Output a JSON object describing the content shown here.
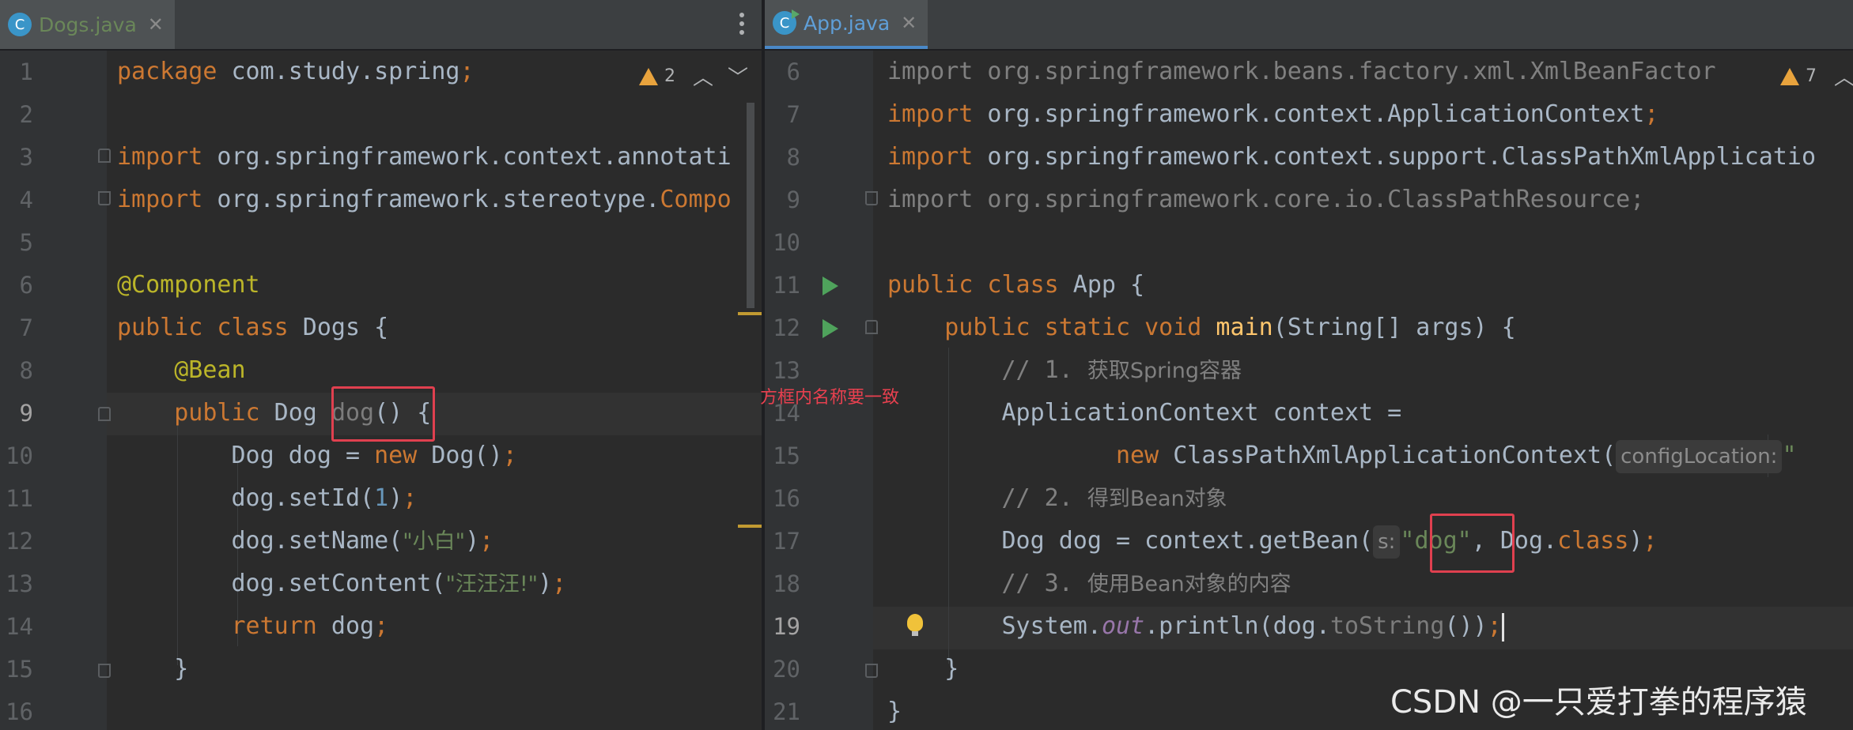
{
  "left_editor": {
    "tab": {
      "icon_letter": "C",
      "title": "Dogs.java",
      "close": "✕"
    },
    "inspection": {
      "warnings": "2"
    },
    "line_numbers": [
      "1",
      "2",
      "3",
      "4",
      "5",
      "6",
      "7",
      "8",
      "9",
      "10",
      "11",
      "12",
      "13",
      "14",
      "15",
      "16"
    ],
    "current_line": "9",
    "lines": {
      "l1": {
        "kw": "package",
        "rest": " com.study.spring",
        "semi": ";"
      },
      "l3": {
        "kw": "import",
        "rest": " org.springframework.context.annotati"
      },
      "l4": {
        "kw": "import",
        "rest": " org.springframework.stereotype.",
        "cls": "Compo"
      },
      "l6": {
        "ann": "@Component"
      },
      "l7": {
        "kw": "public class",
        "rest": " Dogs {"
      },
      "l8": {
        "ann": "@Bean"
      },
      "l9": {
        "kw": "public",
        "type": " Dog ",
        "method": "dog",
        "parens": "()",
        "brace": " {"
      },
      "l10": {
        "a": "Dog dog = ",
        "kw": "new",
        "b": " Dog()",
        "semi": ";"
      },
      "l11": {
        "a": "dog.setId(",
        "num": "1",
        "b": ")",
        "semi": ";"
      },
      "l12": {
        "a": "dog.setName(",
        "str": "\"小白\"",
        "b": ")",
        "semi": ";"
      },
      "l13": {
        "a": "dog.setContent(",
        "str": "\"汪汪汪!\"",
        "b": ")",
        "semi": ";"
      },
      "l14": {
        "kw": "return",
        "rest": " dog",
        "semi": ";"
      },
      "l15": {
        "brace": "}"
      }
    }
  },
  "annotation_note": "方框内名称要一致",
  "right_editor": {
    "tab": {
      "icon_letter": "C",
      "title": "App.java",
      "close": "✕"
    },
    "inspection": {
      "warnings": "7"
    },
    "line_numbers": [
      "6",
      "7",
      "8",
      "9",
      "10",
      "11",
      "12",
      "13",
      "14",
      "15",
      "16",
      "17",
      "18",
      "19",
      "20",
      "21"
    ],
    "current_line": "19",
    "lines": {
      "l6": {
        "kw": "import",
        "rest": " org.springframework.beans.factory.xml.XmlBeanFactor"
      },
      "l7": {
        "kw": "import",
        "rest": " org.springframework.context.ApplicationContext",
        "semi": ";"
      },
      "l8": {
        "kw": "import",
        "rest": " org.springframework.context.support.ClassPathXmlApplicatio"
      },
      "l9": {
        "kw": "import",
        "rest": " org.springframework.core.io.ClassPathResource;"
      },
      "l11": {
        "kw": "public class",
        "rest": " App {"
      },
      "l12": {
        "kw": "public static void",
        "fn": " main",
        "rest": "(String[] args) {"
      },
      "l13": {
        "cmt": "// 1. ",
        "cn": "获取Spring容器"
      },
      "l14": {
        "text": "ApplicationContext context ="
      },
      "l15": {
        "kw": "new",
        "rest": " ClassPathXmlApplicationContext(",
        "hint": "configLocation:",
        "tail": "\""
      },
      "l16": {
        "cmt": "// 2. ",
        "cn": "得到Bean对象"
      },
      "l17": {
        "a": "Dog dog = context.getBean(",
        "hint": "s:",
        "str": "\"dog\"",
        "b": ", Dog.",
        "kw": "class",
        "c": ")",
        "semi": ";"
      },
      "l18": {
        "cmt": "// 3. ",
        "cn": "使用Bean对象的内容"
      },
      "l19": {
        "a": "System.",
        "fld": "out",
        "b": ".println(dog.",
        "m": "toString",
        "c": "())",
        "semi": ";"
      },
      "l20": {
        "brace": "}"
      },
      "l21": {
        "brace": "}"
      }
    }
  },
  "watermark": "CSDN @一只爱打拳的程序猿"
}
